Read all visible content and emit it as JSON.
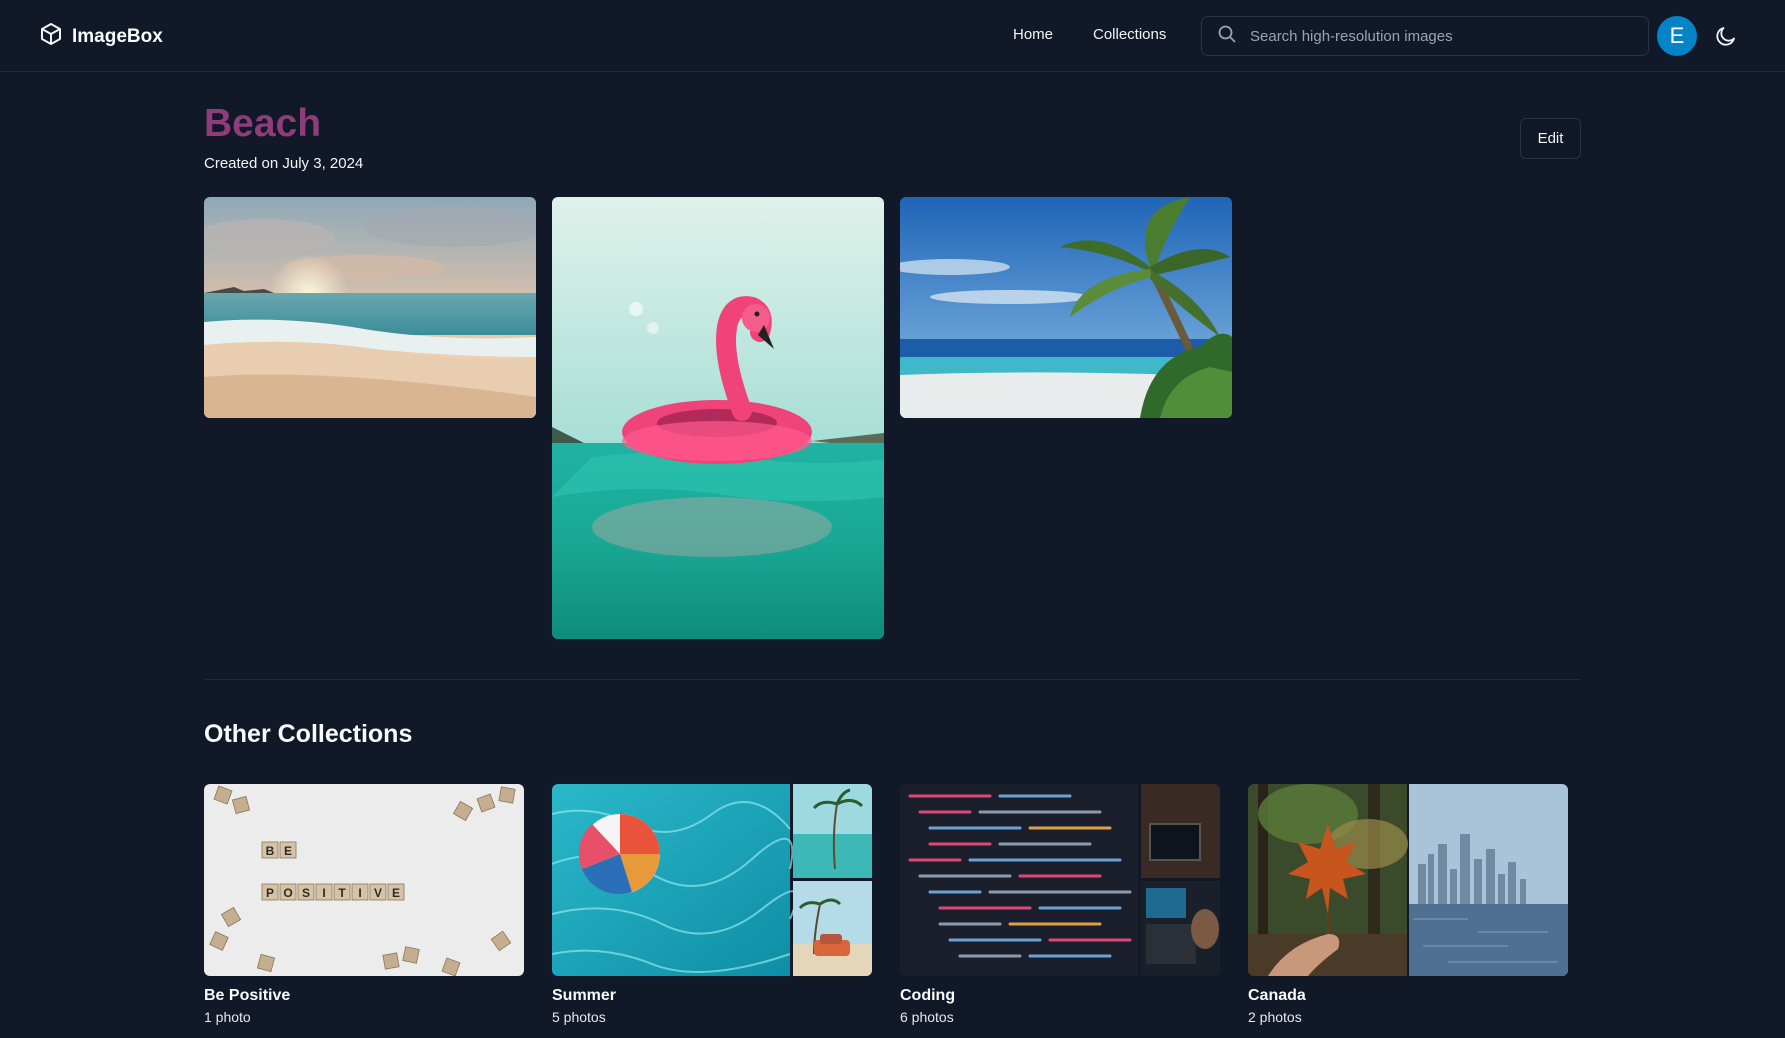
{
  "app": {
    "name": "ImageBox"
  },
  "nav": {
    "links": [
      "Home",
      "Collections"
    ],
    "search_placeholder": "Search high-resolution images",
    "avatar_initial": "E"
  },
  "collection": {
    "title": "Beach",
    "created": "Created on July 3, 2024",
    "edit_label": "Edit"
  },
  "other": {
    "heading": "Other Collections",
    "cards": [
      {
        "name": "Be Positive",
        "count": "1 photo"
      },
      {
        "name": "Summer",
        "count": "5 photos"
      },
      {
        "name": "Coding",
        "count": "6 photos"
      },
      {
        "name": "Canada",
        "count": "2 photos"
      }
    ]
  },
  "scrabble_letters": [
    "B",
    "E",
    "P",
    "O",
    "S",
    "I",
    "T",
    "I",
    "V",
    "E"
  ],
  "colors": {
    "background": "#111827",
    "title": "#8e3c7a",
    "avatar": "#0284c7",
    "border": "#2a3342"
  }
}
